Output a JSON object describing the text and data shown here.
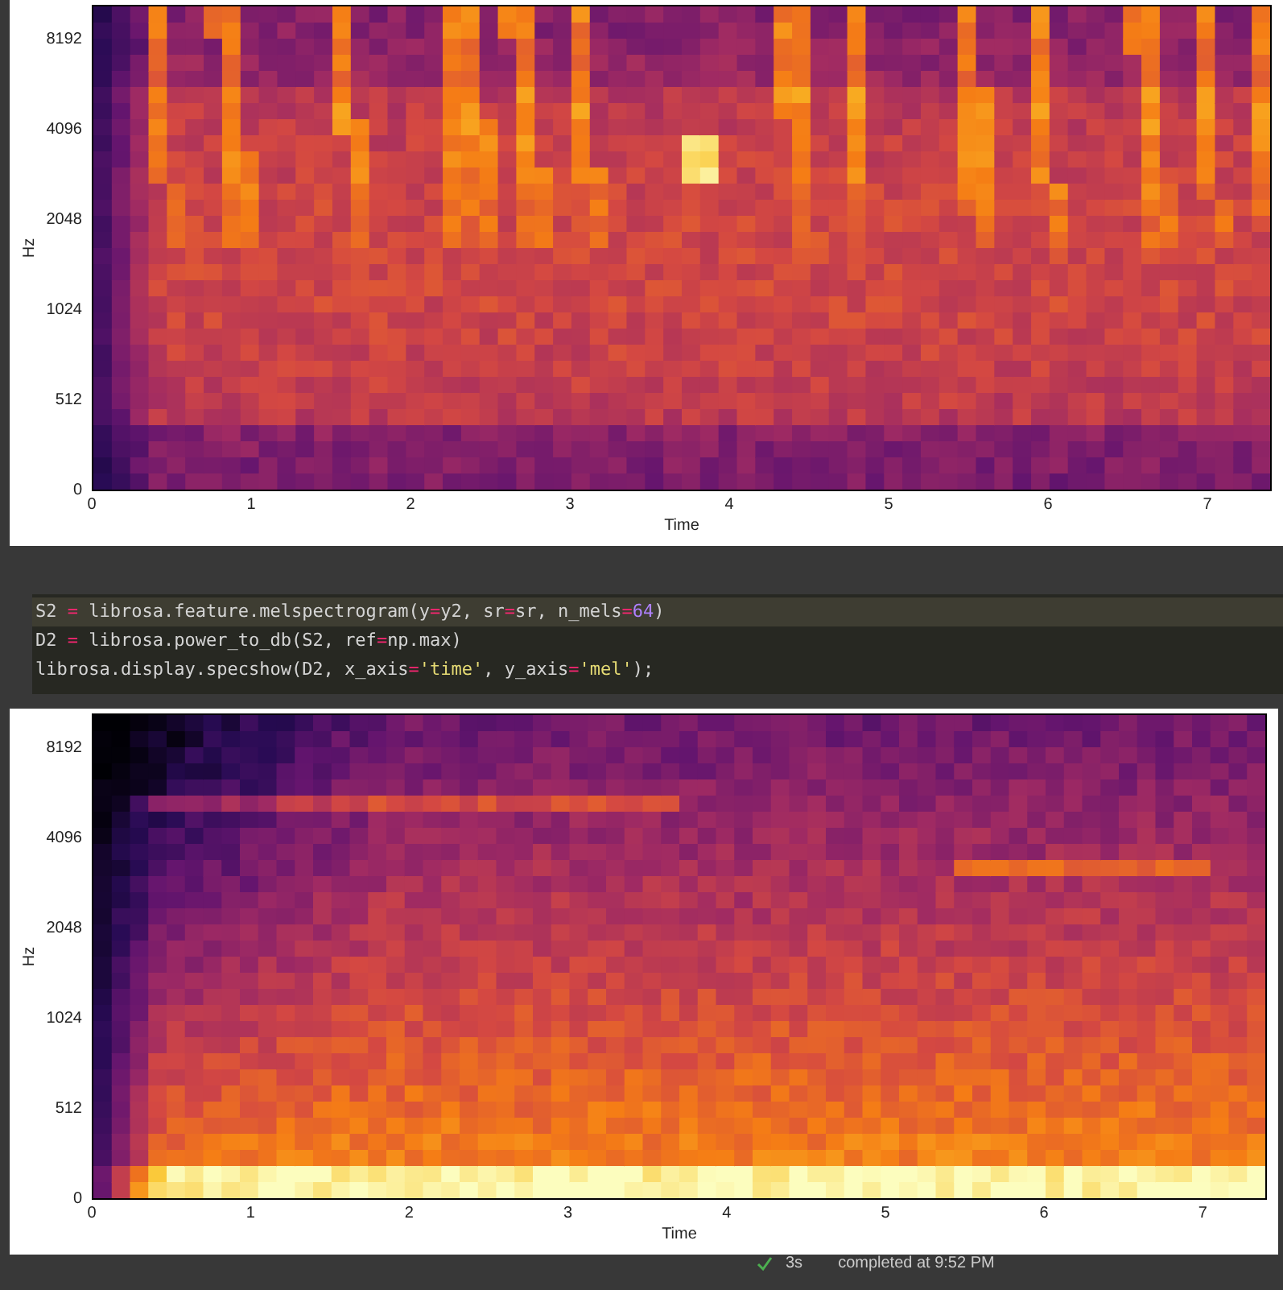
{
  "plots": [
    {
      "y_label": "Hz",
      "x_label": "Time",
      "yticks": [
        "8192",
        "4096",
        "2048",
        "1024",
        "512",
        "0"
      ],
      "xticks": [
        "0",
        "1",
        "2",
        "3",
        "4",
        "5",
        "6",
        "7"
      ]
    },
    {
      "y_label": "Hz",
      "x_label": "Time",
      "yticks": [
        "8192",
        "4096",
        "2048",
        "1024",
        "512",
        "0"
      ],
      "xticks": [
        "0",
        "1",
        "2",
        "3",
        "4",
        "5",
        "6",
        "7"
      ]
    }
  ],
  "code_cell": {
    "lines": [
      {
        "highlighted": true,
        "tokens": [
          {
            "kind": "text",
            "text": "S2 "
          },
          {
            "kind": "op",
            "text": "="
          },
          {
            "kind": "text",
            "text": " librosa.feature.melspectrogram(y"
          },
          {
            "kind": "op",
            "text": "="
          },
          {
            "kind": "text",
            "text": "y2, sr"
          },
          {
            "kind": "op",
            "text": "="
          },
          {
            "kind": "text",
            "text": "sr, n_mels"
          },
          {
            "kind": "op",
            "text": "="
          },
          {
            "kind": "num",
            "text": "64"
          },
          {
            "kind": "text",
            "text": ")"
          }
        ]
      },
      {
        "highlighted": false,
        "tokens": [
          {
            "kind": "text",
            "text": "D2 "
          },
          {
            "kind": "op",
            "text": "="
          },
          {
            "kind": "text",
            "text": " librosa.power_to_db(S2, ref"
          },
          {
            "kind": "op",
            "text": "="
          },
          {
            "kind": "text",
            "text": "np.max)"
          }
        ]
      },
      {
        "highlighted": false,
        "tokens": [
          {
            "kind": "text",
            "text": "librosa.display.specshow(D2, x_axis"
          },
          {
            "kind": "op",
            "text": "="
          },
          {
            "kind": "str",
            "text": "'time'"
          },
          {
            "kind": "text",
            "text": ", y_axis"
          },
          {
            "kind": "op",
            "text": "="
          },
          {
            "kind": "str",
            "text": "'mel'"
          },
          {
            "kind": "text",
            "text": ");"
          }
        ]
      }
    ]
  },
  "status_bar": {
    "duration": "3s",
    "message": "completed at 9:52 PM"
  }
}
